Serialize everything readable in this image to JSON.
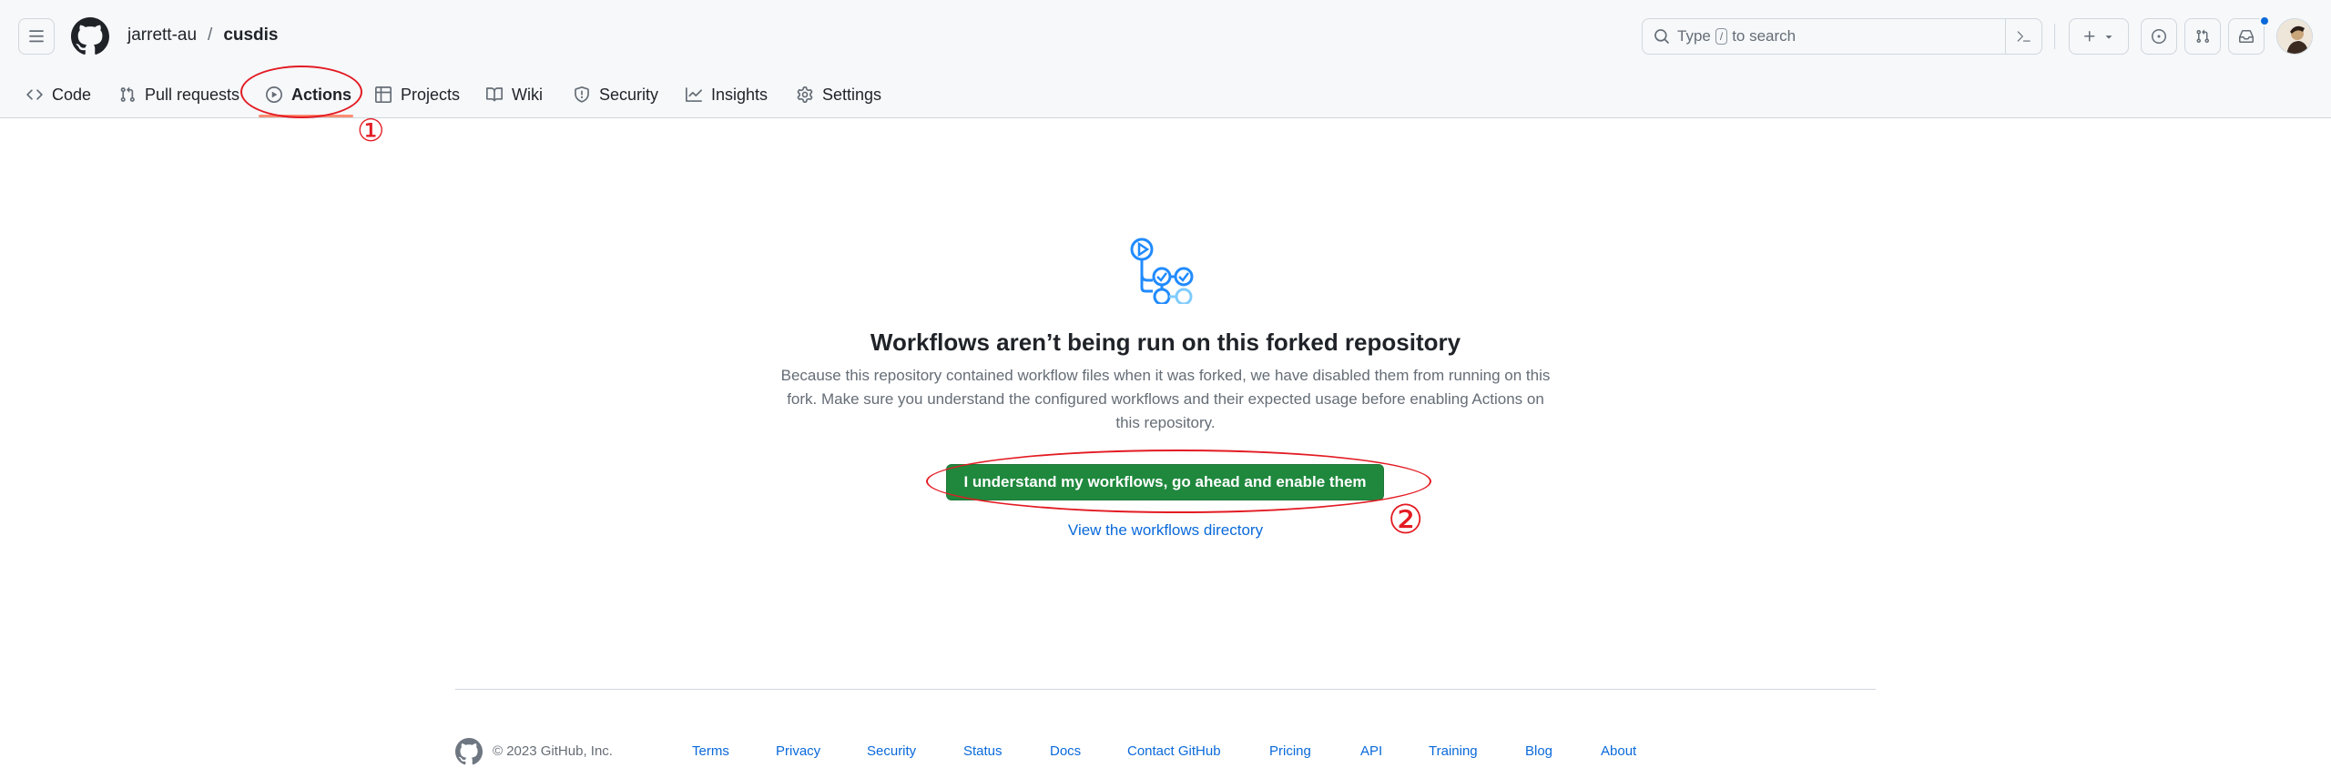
{
  "header": {
    "owner": "jarrett-au",
    "separator": "/",
    "repo": "cusdis",
    "search": {
      "prefix": "Type",
      "key": "/",
      "suffix": "to search"
    }
  },
  "tabs": [
    {
      "label": "Code",
      "icon": "code-icon"
    },
    {
      "label": "Pull requests",
      "icon": "git-pull-request-icon"
    },
    {
      "label": "Actions",
      "icon": "play-icon",
      "selected": true
    },
    {
      "label": "Projects",
      "icon": "table-icon"
    },
    {
      "label": "Wiki",
      "icon": "book-icon"
    },
    {
      "label": "Security",
      "icon": "shield-icon"
    },
    {
      "label": "Insights",
      "icon": "graph-icon"
    },
    {
      "label": "Settings",
      "icon": "gear-icon"
    }
  ],
  "annotations": {
    "step1": "①",
    "step2": "②",
    "color": "#e31b23"
  },
  "main": {
    "title": "Workflows aren’t being run on this forked repository",
    "description": "Because this repository contained workflow files when it was forked, we have disabled them from running on this fork. Make sure you understand the configured workflows and their expected usage before enabling Actions on this repository.",
    "enable_button": "I understand my workflows, go ahead and enable them",
    "workflows_link": "View the workflows directory"
  },
  "footer": {
    "copyright": "© 2023 GitHub, Inc.",
    "links": [
      "Terms",
      "Privacy",
      "Security",
      "Status",
      "Docs",
      "Contact GitHub",
      "Pricing",
      "API",
      "Training",
      "Blog",
      "About"
    ]
  },
  "colors": {
    "primary_button": "#1f883d",
    "link": "#0969da",
    "tab_underline": "#fd8c73",
    "header_bg": "#f6f8fa"
  }
}
